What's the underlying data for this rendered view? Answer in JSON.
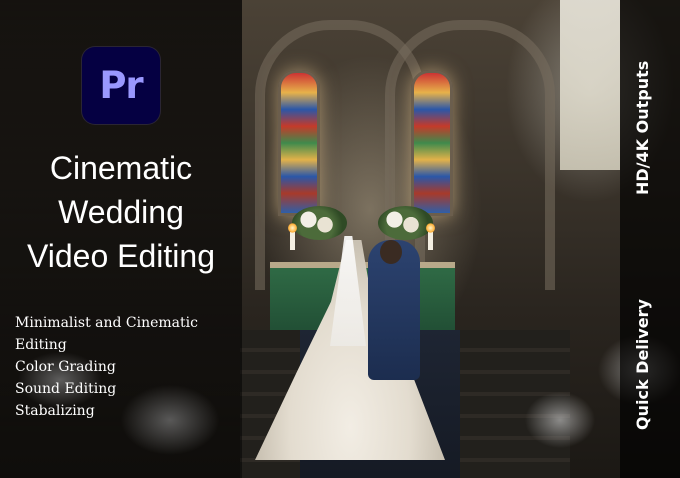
{
  "logo": {
    "text": "Pr"
  },
  "title": {
    "line1": "Cinematic",
    "line2": "Wedding",
    "line3": "Video Editing"
  },
  "features": [
    "Minimalist and Cinematic",
    "Editing",
    "Color Grading",
    "Sound Editing",
    "Stabalizing"
  ],
  "side_labels": {
    "top": "HD/4K Outputs",
    "bottom": "Quick Delivery"
  },
  "colors": {
    "logo_bg": "#050042",
    "logo_text": "#9a98ff",
    "text": "#ffffff"
  }
}
